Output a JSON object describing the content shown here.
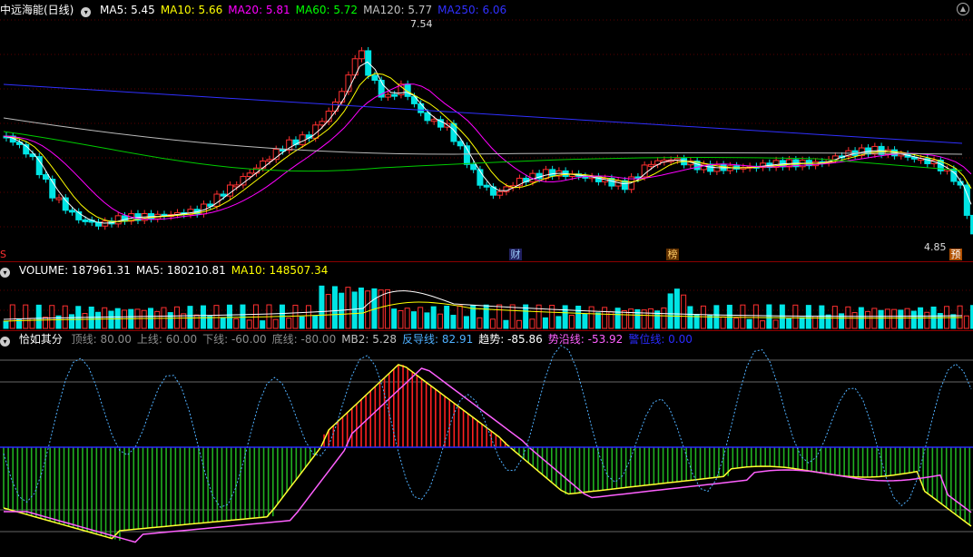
{
  "main": {
    "stock_name": "中远海能(日线)",
    "ma_labels": [
      {
        "text": "MA5: 5.45",
        "color": "#ffffff"
      },
      {
        "text": "MA10: 5.66",
        "color": "#ffff00"
      },
      {
        "text": "MA20: 5.81",
        "color": "#ff00ff"
      },
      {
        "text": "MA60: 5.72",
        "color": "#00ff00"
      },
      {
        "text": "MA120: 5.77",
        "color": "#c0c0c0"
      },
      {
        "text": "MA250: 6.06",
        "color": "#3030ff"
      }
    ],
    "high_label": "7.54",
    "low_label": "4.85",
    "left_marker": "S",
    "event_tags": [
      "财",
      "榜"
    ],
    "forecast_tag": "预"
  },
  "volume": {
    "labels": [
      {
        "text": "VOLUME: 187961.31",
        "color": "#ffffff"
      },
      {
        "text": "MA5: 180210.81",
        "color": "#ffffff"
      },
      {
        "text": "MA10: 148507.34",
        "color": "#ffff00"
      }
    ]
  },
  "indicator": {
    "name": "恰如其分",
    "labels": [
      {
        "text": "顶线: 80.00",
        "color": "#8c8c8c"
      },
      {
        "text": "上线: 60.00",
        "color": "#8c8c8c"
      },
      {
        "text": "下线: -60.00",
        "color": "#8c8c8c"
      },
      {
        "text": "底线: -80.00",
        "color": "#8c8c8c"
      },
      {
        "text": "MB2: 5.28",
        "color": "#c0c0c0"
      },
      {
        "text": "反导线: 82.91",
        "color": "#4fb0ff"
      },
      {
        "text": "趋势: -85.86",
        "color": "#ffffff"
      },
      {
        "text": "势沿线: -53.92",
        "color": "#ff60ff"
      },
      {
        "text": "警位线: 0.00",
        "color": "#2b2bff"
      }
    ]
  }
}
